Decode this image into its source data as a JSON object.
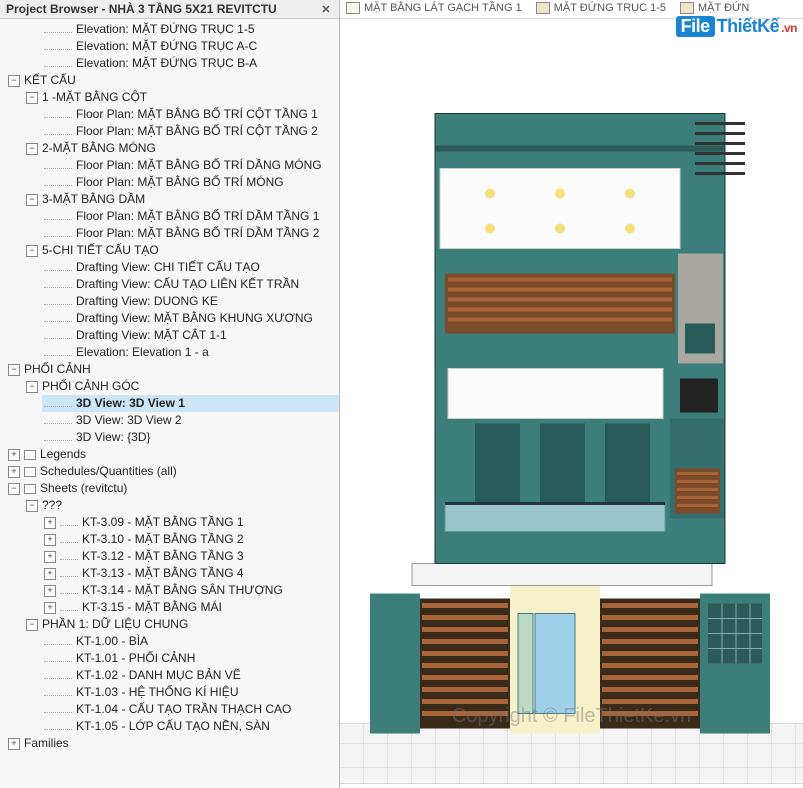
{
  "panel": {
    "title": "Project Browser - NHÀ 3 TẦNG 5X21 REVITCTU",
    "close": "✕"
  },
  "tabs": [
    {
      "label": "MẶT BẰNG LÁT GẠCH TẦNG 1"
    },
    {
      "label": "MẶT ĐỨNG TRỤC 1-5"
    },
    {
      "label": "MẶT ĐỨN"
    }
  ],
  "logo": {
    "brand": "File",
    "mid": "ThiếtKế",
    "suffix": ".vn"
  },
  "copyright": "Copyright  ©  FileThietKe.vn",
  "tree": {
    "elev15": "Elevation: MẶT ĐỨNG TRỤC 1-5",
    "elevAC": "Elevation: MẶT ĐỨNG TRỤC A-C",
    "elevBA": "Elevation: MẶT ĐỨNG TRỤC B-A",
    "ketcau": "KẾT CẤU",
    "mbCot": "1 -MẶT BẰNG CỘT",
    "fpCot1": "Floor Plan: MẶT BẰNG BỐ TRÍ CỘT TẦNG 1",
    "fpCot2": "Floor Plan: MẶT BẰNG BỐ TRÍ CỘT TẦNG 2",
    "mbMong": "2-MẶT BẰNG MÓNG",
    "fpMong1": "Floor Plan: MẶT BẰNG BỐ TRÍ DẦNG MÓNG",
    "fpMong2": "Floor Plan: MẶT BẰNG BỐ TRÍ MÓNG",
    "mbDam": "3-MẶT BẰNG DẦM",
    "fpDam1": "Floor Plan: MẶT BẰNG BỐ TRÍ DẦM TẦNG 1",
    "fpDam2": "Floor Plan: MẶT BẰNG BỐ TRÍ DẦM TẦNG 2",
    "chiTiet": "5-CHI TIẾT CẤU TẠO",
    "dvCTCT": "Drafting View: CHI TIẾT CẤU TẠO",
    "dvLKT": "Drafting View: CẤU TẠO LIÊN KẾT TRẦN",
    "dvDK": "Drafting View: DUONG KE",
    "dvKX": "Drafting View: MẶT BẰNG KHUNG XƯƠNG",
    "dvMC11": "Drafting View: MẶT CẮT 1-1",
    "elev1a": "Elevation: Elevation 1 - a",
    "phoiCanh": "PHỐI CẢNH",
    "phoiCanhGoc": "PHỐI CẢNH GÓC",
    "v3d1": "3D View: 3D View 1",
    "v3d2": "3D View: 3D View 2",
    "v3d3": "3D View: {3D}",
    "legends": "Legends",
    "sched": "Schedules/Quantities (all)",
    "sheets": "Sheets (revitctu)",
    "qqq": "???",
    "kt309": "KT-3.09 - MẶT BẰNG TẦNG 1",
    "kt310": "KT-3.10 - MẶT BẰNG TẦNG 2",
    "kt312": "KT-3.12 - MẶT BẰNG TẦNG 3",
    "kt313": "KT-3.13 - MẶT BẰNG TẦNG 4",
    "kt314": "KT-3.14 - MẶT BẰNG SÂN THƯỢNG",
    "kt315": "KT-3.15 - MẶT BẰNG MÁI",
    "phan1": "PHẦN 1: DỮ LIỆU CHUNG",
    "kt100": "KT-1.00 - BÌA",
    "kt101": "KT-1.01 - PHỐI CẢNH",
    "kt102": "KT-1.02 - DANH MỤC BẢN VẼ",
    "kt103": "KT-1.03 - HỆ THỐNG KÍ HIỆU",
    "kt104": "KT-1.04 - CẤU TẠO TRẦN THẠCH CAO",
    "kt105": "KT-1.05 - LỚP CẤU TẠO NỀN, SÀN",
    "families": "Families"
  }
}
